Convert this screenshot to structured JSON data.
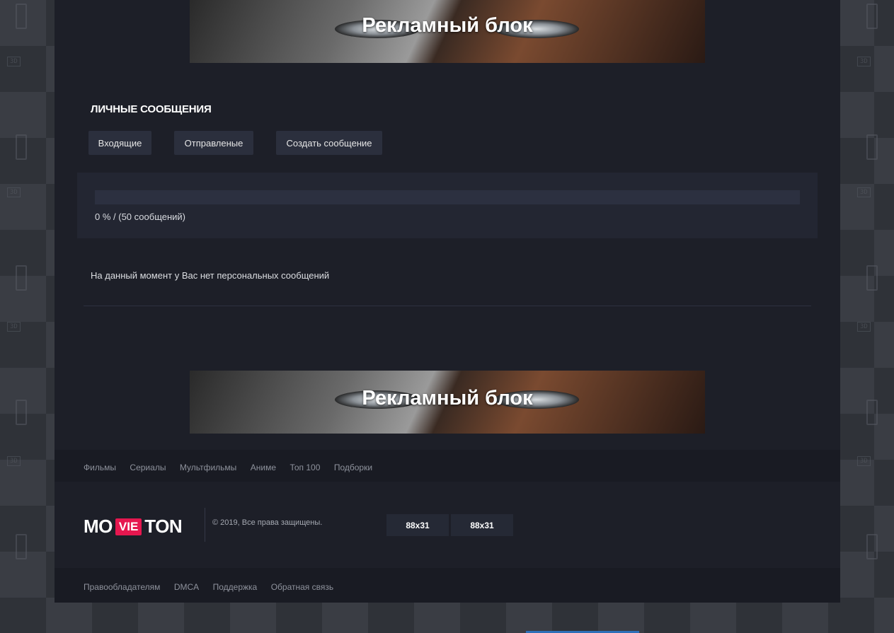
{
  "ads": {
    "top_text": "Рекламный блок",
    "bottom_text": "Рекламный блок"
  },
  "messages": {
    "title": "ЛИЧНЫЕ СООБЩЕНИЯ",
    "tabs": {
      "inbox": "Входящие",
      "sent": "Отправленые",
      "create": "Создать сообщение"
    },
    "quota": {
      "percent": 0,
      "text": "0 % / (50 сообщений)"
    },
    "empty_text": "На данный момент у Вас нет персональных сообщений"
  },
  "footer": {
    "nav": [
      "Фильмы",
      "Сериалы",
      "Мультфильмы",
      "Аниме",
      "Топ 100",
      "Подборки"
    ],
    "logo": {
      "part1": "MO",
      "part2": "VIE",
      "part3": "TON"
    },
    "copyright": "© 2019, Все права защищены.",
    "counters": [
      "88x31",
      "88x31"
    ],
    "bottom_links": [
      "Правообладателям",
      "DMCA",
      "Поддержка",
      "Обратная связь"
    ]
  },
  "colors": {
    "accent": "#e6174f",
    "page_bg": "#1d1f28",
    "button_bg": "#2b2f3d"
  }
}
